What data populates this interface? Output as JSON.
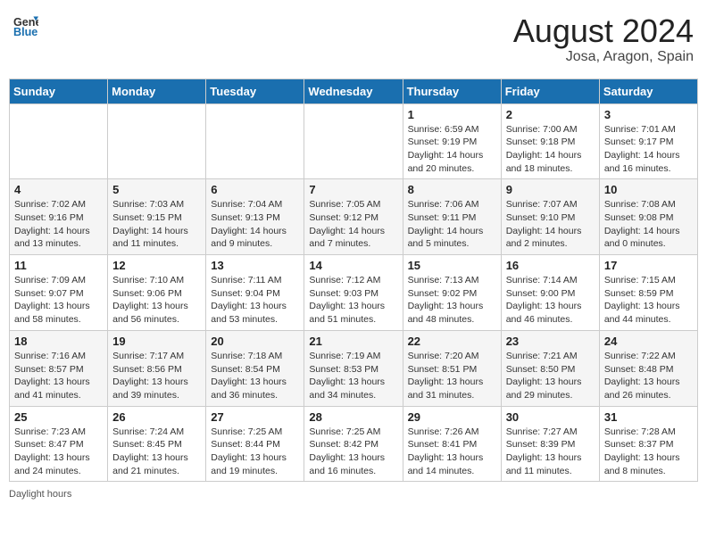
{
  "header": {
    "logo_general": "General",
    "logo_blue": "Blue",
    "month_year": "August 2024",
    "location": "Josa, Aragon, Spain"
  },
  "days_of_week": [
    "Sunday",
    "Monday",
    "Tuesday",
    "Wednesday",
    "Thursday",
    "Friday",
    "Saturday"
  ],
  "weeks": [
    [
      {
        "day": "",
        "info": ""
      },
      {
        "day": "",
        "info": ""
      },
      {
        "day": "",
        "info": ""
      },
      {
        "day": "",
        "info": ""
      },
      {
        "day": "1",
        "info": "Sunrise: 6:59 AM\nSunset: 9:19 PM\nDaylight: 14 hours and 20 minutes."
      },
      {
        "day": "2",
        "info": "Sunrise: 7:00 AM\nSunset: 9:18 PM\nDaylight: 14 hours and 18 minutes."
      },
      {
        "day": "3",
        "info": "Sunrise: 7:01 AM\nSunset: 9:17 PM\nDaylight: 14 hours and 16 minutes."
      }
    ],
    [
      {
        "day": "4",
        "info": "Sunrise: 7:02 AM\nSunset: 9:16 PM\nDaylight: 14 hours and 13 minutes."
      },
      {
        "day": "5",
        "info": "Sunrise: 7:03 AM\nSunset: 9:15 PM\nDaylight: 14 hours and 11 minutes."
      },
      {
        "day": "6",
        "info": "Sunrise: 7:04 AM\nSunset: 9:13 PM\nDaylight: 14 hours and 9 minutes."
      },
      {
        "day": "7",
        "info": "Sunrise: 7:05 AM\nSunset: 9:12 PM\nDaylight: 14 hours and 7 minutes."
      },
      {
        "day": "8",
        "info": "Sunrise: 7:06 AM\nSunset: 9:11 PM\nDaylight: 14 hours and 5 minutes."
      },
      {
        "day": "9",
        "info": "Sunrise: 7:07 AM\nSunset: 9:10 PM\nDaylight: 14 hours and 2 minutes."
      },
      {
        "day": "10",
        "info": "Sunrise: 7:08 AM\nSunset: 9:08 PM\nDaylight: 14 hours and 0 minutes."
      }
    ],
    [
      {
        "day": "11",
        "info": "Sunrise: 7:09 AM\nSunset: 9:07 PM\nDaylight: 13 hours and 58 minutes."
      },
      {
        "day": "12",
        "info": "Sunrise: 7:10 AM\nSunset: 9:06 PM\nDaylight: 13 hours and 56 minutes."
      },
      {
        "day": "13",
        "info": "Sunrise: 7:11 AM\nSunset: 9:04 PM\nDaylight: 13 hours and 53 minutes."
      },
      {
        "day": "14",
        "info": "Sunrise: 7:12 AM\nSunset: 9:03 PM\nDaylight: 13 hours and 51 minutes."
      },
      {
        "day": "15",
        "info": "Sunrise: 7:13 AM\nSunset: 9:02 PM\nDaylight: 13 hours and 48 minutes."
      },
      {
        "day": "16",
        "info": "Sunrise: 7:14 AM\nSunset: 9:00 PM\nDaylight: 13 hours and 46 minutes."
      },
      {
        "day": "17",
        "info": "Sunrise: 7:15 AM\nSunset: 8:59 PM\nDaylight: 13 hours and 44 minutes."
      }
    ],
    [
      {
        "day": "18",
        "info": "Sunrise: 7:16 AM\nSunset: 8:57 PM\nDaylight: 13 hours and 41 minutes."
      },
      {
        "day": "19",
        "info": "Sunrise: 7:17 AM\nSunset: 8:56 PM\nDaylight: 13 hours and 39 minutes."
      },
      {
        "day": "20",
        "info": "Sunrise: 7:18 AM\nSunset: 8:54 PM\nDaylight: 13 hours and 36 minutes."
      },
      {
        "day": "21",
        "info": "Sunrise: 7:19 AM\nSunset: 8:53 PM\nDaylight: 13 hours and 34 minutes."
      },
      {
        "day": "22",
        "info": "Sunrise: 7:20 AM\nSunset: 8:51 PM\nDaylight: 13 hours and 31 minutes."
      },
      {
        "day": "23",
        "info": "Sunrise: 7:21 AM\nSunset: 8:50 PM\nDaylight: 13 hours and 29 minutes."
      },
      {
        "day": "24",
        "info": "Sunrise: 7:22 AM\nSunset: 8:48 PM\nDaylight: 13 hours and 26 minutes."
      }
    ],
    [
      {
        "day": "25",
        "info": "Sunrise: 7:23 AM\nSunset: 8:47 PM\nDaylight: 13 hours and 24 minutes."
      },
      {
        "day": "26",
        "info": "Sunrise: 7:24 AM\nSunset: 8:45 PM\nDaylight: 13 hours and 21 minutes."
      },
      {
        "day": "27",
        "info": "Sunrise: 7:25 AM\nSunset: 8:44 PM\nDaylight: 13 hours and 19 minutes."
      },
      {
        "day": "28",
        "info": "Sunrise: 7:25 AM\nSunset: 8:42 PM\nDaylight: 13 hours and 16 minutes."
      },
      {
        "day": "29",
        "info": "Sunrise: 7:26 AM\nSunset: 8:41 PM\nDaylight: 13 hours and 14 minutes."
      },
      {
        "day": "30",
        "info": "Sunrise: 7:27 AM\nSunset: 8:39 PM\nDaylight: 13 hours and 11 minutes."
      },
      {
        "day": "31",
        "info": "Sunrise: 7:28 AM\nSunset: 8:37 PM\nDaylight: 13 hours and 8 minutes."
      }
    ]
  ],
  "footer": {
    "daylight_label": "Daylight hours"
  }
}
